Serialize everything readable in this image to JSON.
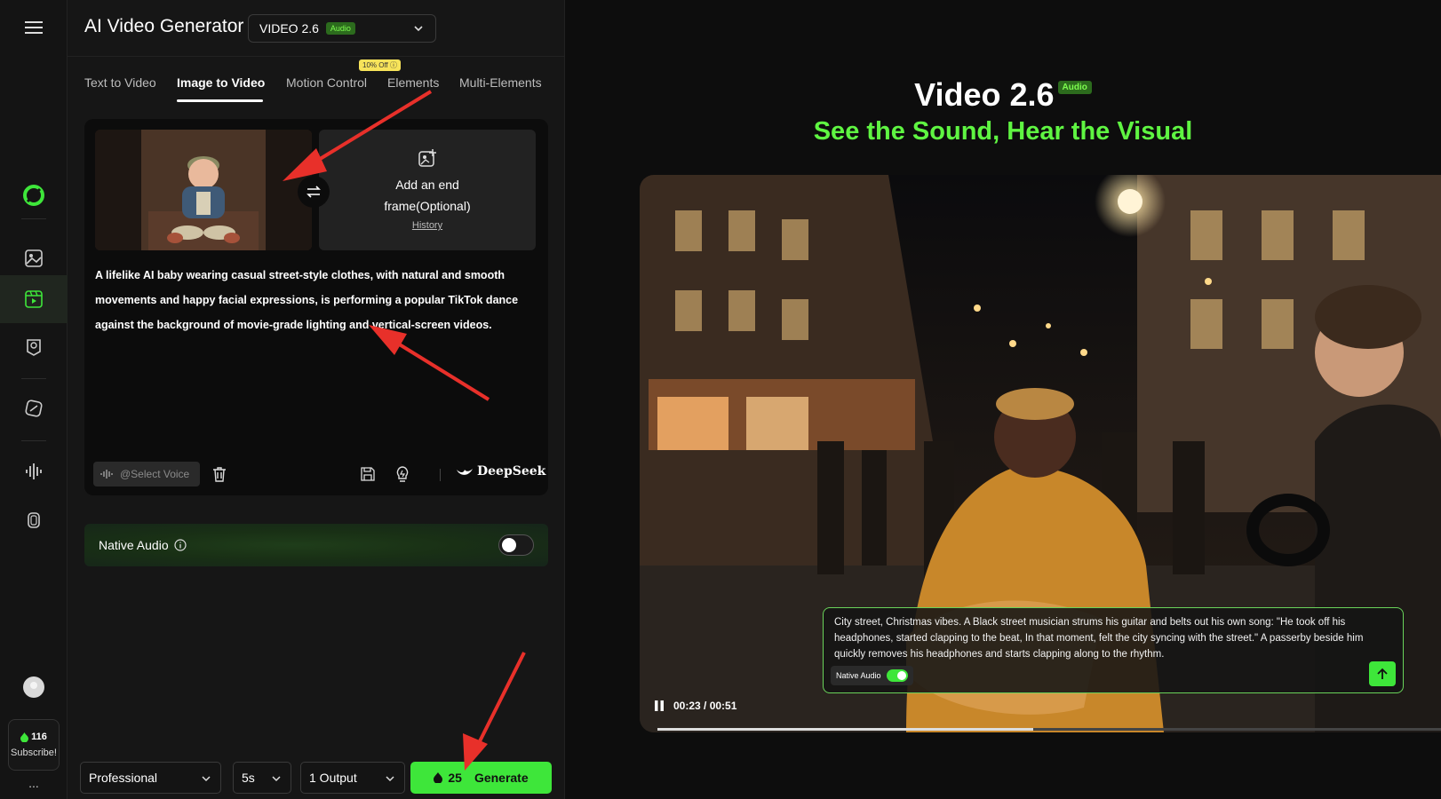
{
  "app": {
    "title": "AI Video Generator"
  },
  "model_select": {
    "value": "VIDEO 2.6",
    "badge": "Audio"
  },
  "tabs": [
    {
      "label": "Text to Video",
      "active": false
    },
    {
      "label": "Image to Video",
      "active": true
    },
    {
      "label": "Motion Control",
      "active": false,
      "promo": "10% Off ⓘ"
    },
    {
      "label": "Elements",
      "active": false
    },
    {
      "label": "Multi-Elements",
      "active": false
    }
  ],
  "end_frame": {
    "label": "Add an end frame(Optional)",
    "history": "History"
  },
  "prompt": "A lifelike AI baby wearing casual street-style clothes, with natural and smooth movements and happy facial expressions, is performing a popular TikTok dance against the background of movie-grade lighting and vertical-screen videos.",
  "tools": {
    "voice_placeholder": "@Select Voice",
    "deepseek": "DeepSeek"
  },
  "native_audio": {
    "label": "Native Audio",
    "enabled": false
  },
  "credits": {
    "count": "116",
    "subscribe": "Subscribe!"
  },
  "rail": {
    "more": "..."
  },
  "options": {
    "quality": "Professional",
    "duration": "5s",
    "outputs": "1 Output"
  },
  "generate": {
    "cost": "25",
    "label": "Generate"
  },
  "showcase": {
    "title": "Video 2.6",
    "badge": "Audio",
    "subtitle": "See the Sound, Hear the Visual",
    "caption": "City street, Christmas vibes. A Black street musician strums his guitar and belts out his own song: \"He took off his headphones, started clapping to the beat, In that moment, felt the city syncing with the street.\" A passerby beside him quickly removes his headphones and starts clapping along to the rhythm.",
    "native_audio_label": "Native Audio",
    "native_audio_enabled": true,
    "time": "00:23 / 00:51",
    "progress": 0.48
  },
  "colors": {
    "accent": "#3ee63a",
    "subtitle": "#5ff542",
    "annotation": "#e8302a"
  },
  "icons": [
    "menu-icon",
    "logo-icon",
    "image-icon",
    "video-icon",
    "avatar-tool-icon",
    "effects-icon",
    "audio-icon",
    "clone-icon",
    "swap-icon",
    "upload-image-icon",
    "waveform-icon",
    "trash-icon",
    "save-icon",
    "lightbulb-icon",
    "deepseek-whale-icon",
    "info-icon",
    "flame-icon",
    "chevron-down-icon",
    "pause-icon",
    "arrow-up-icon"
  ]
}
